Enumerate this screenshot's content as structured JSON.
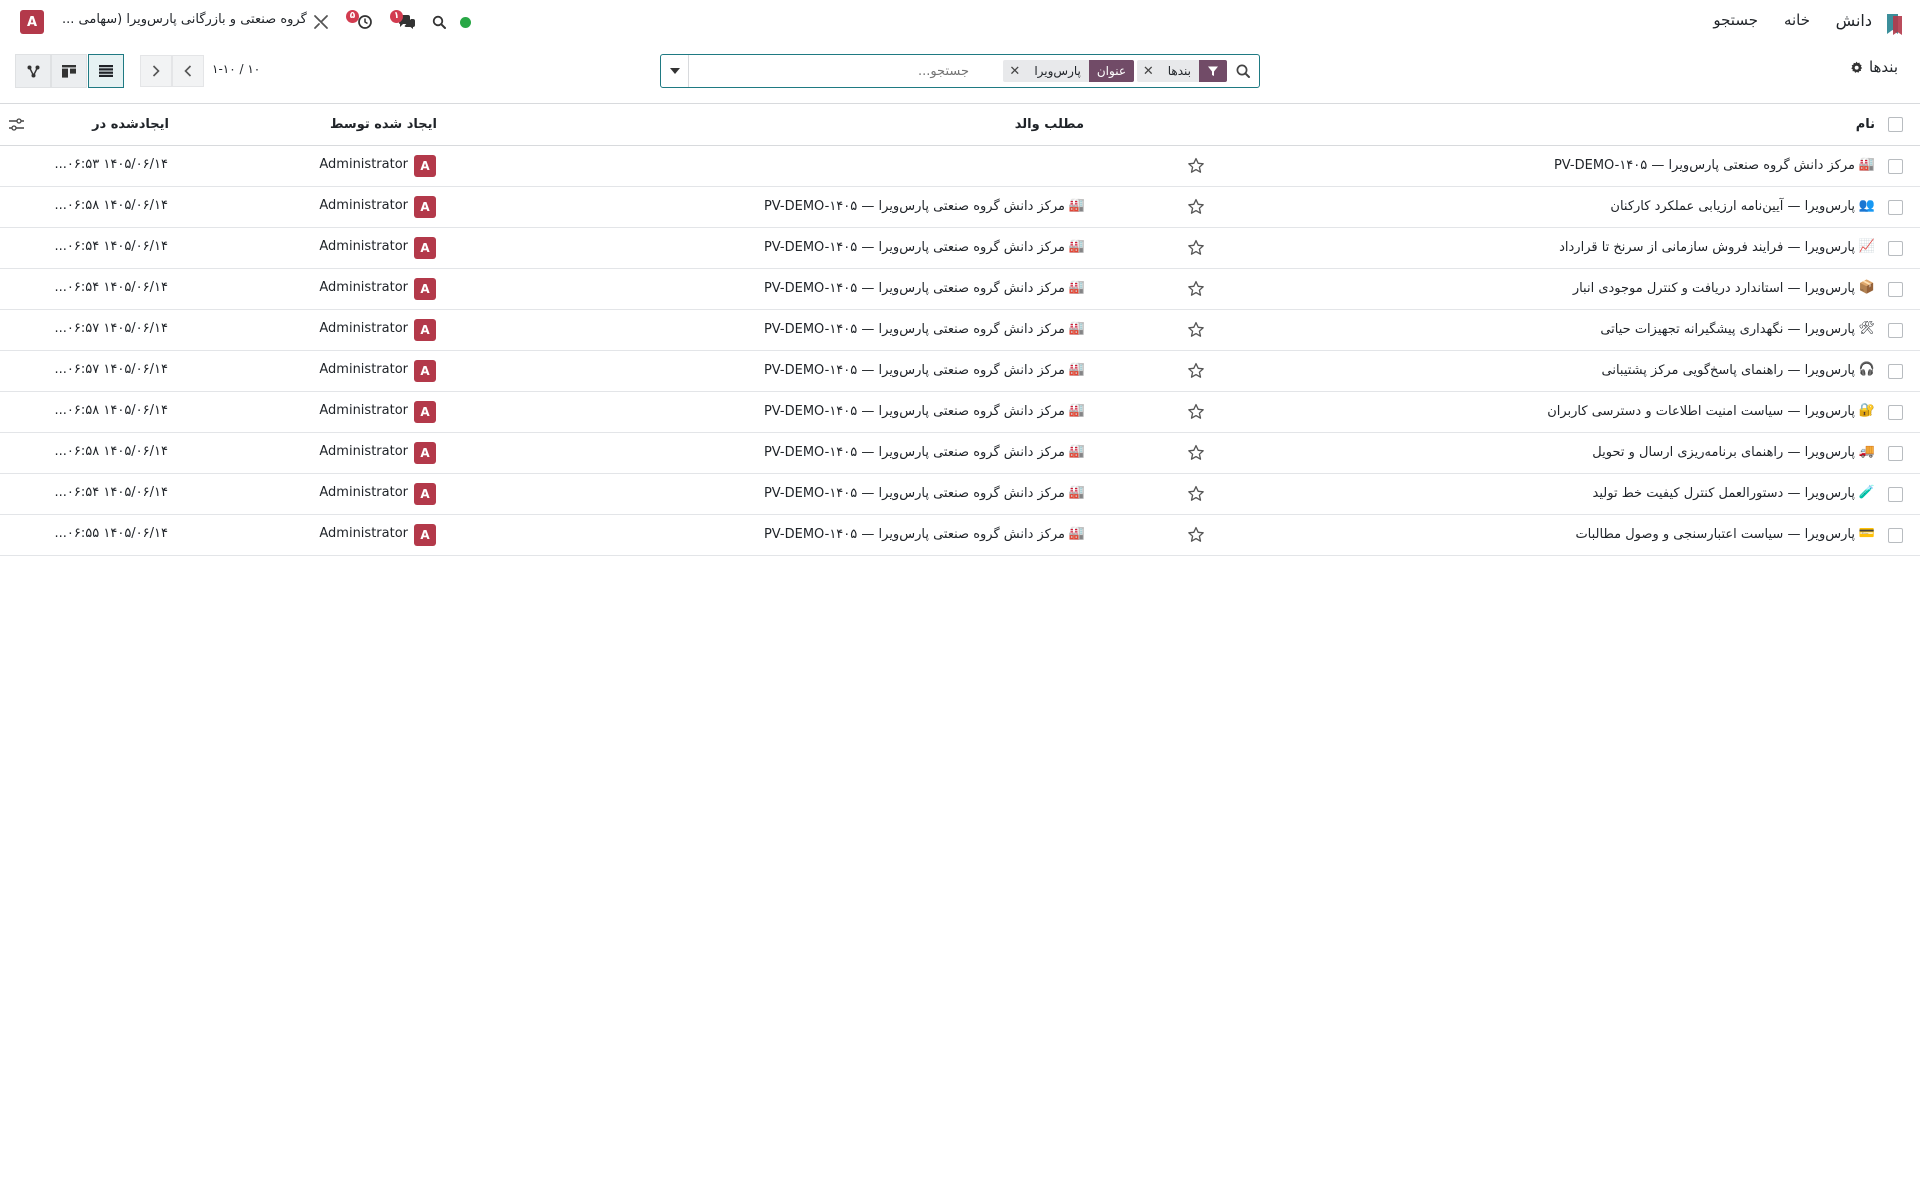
{
  "navbar": {
    "app_name": "دانش",
    "menu": [
      "خانه",
      "جستجو"
    ],
    "company": "گروه صنعتی و بازرگانی پارس‌ویرا (سهامی ...",
    "user_initial": "A",
    "activity_badge": "۵",
    "messages_badge": "۱",
    "icons": [
      "knowledge-logo-icon",
      "search-icon",
      "messages-icon",
      "activity-clock-icon",
      "tools-icon",
      "status-online-icon"
    ],
    "colors": {
      "badge": "#d23c50",
      "online": "#28a745",
      "avatar": "#b3394a"
    }
  },
  "control_panel": {
    "title": "بندها",
    "search": {
      "facets": [
        {
          "label": "بندها",
          "type": "filter"
        },
        {
          "label": "عنوان",
          "value": "پارس‌ویرا",
          "type": "field"
        }
      ],
      "placeholder": "جستجو..."
    },
    "pager": "۱-۱۰ / ۱۰",
    "views": [
      "list",
      "kanban",
      "hierarchy"
    ],
    "active_view": "list",
    "colors": {
      "facet": "#714b67",
      "accent": "#1f7a83"
    }
  },
  "table": {
    "headers": {
      "name": "نام",
      "parent": "مطلب والد",
      "created_by": "ایجاد شده توسط",
      "created_on": "ایجادشده در"
    },
    "rows": [
      {
        "icon": "🏭",
        "name": "مرکز دانش گروه صنعتی پارس‌ویرا — PV-DEMO-۱۴۰۵",
        "parent_icon": "",
        "parent": "",
        "creator_initial": "A",
        "creator": "Administrator",
        "created": "۱۴۰۵/۰۶/۱۴ ۰۶:۵۳..."
      },
      {
        "icon": "👥",
        "name": "پارس‌ویرا — آیین‌نامه ارزیابی عملکرد کارکنان",
        "parent_icon": "🏭",
        "parent": "مرکز دانش گروه صنعتی پارس‌ویرا — PV-DEMO-۱۴۰۵",
        "creator_initial": "A",
        "creator": "Administrator",
        "created": "۱۴۰۵/۰۶/۱۴ ۰۶:۵۸..."
      },
      {
        "icon": "📈",
        "name": "پارس‌ویرا — فرایند فروش سازمانی از سرنخ تا قرارداد",
        "parent_icon": "🏭",
        "parent": "مرکز دانش گروه صنعتی پارس‌ویرا — PV-DEMO-۱۴۰۵",
        "creator_initial": "A",
        "creator": "Administrator",
        "created": "۱۴۰۵/۰۶/۱۴ ۰۶:۵۴..."
      },
      {
        "icon": "📦",
        "name": "پارس‌ویرا — استاندارد دریافت و کنترل موجودی انبار",
        "parent_icon": "🏭",
        "parent": "مرکز دانش گروه صنعتی پارس‌ویرا — PV-DEMO-۱۴۰۵",
        "creator_initial": "A",
        "creator": "Administrator",
        "created": "۱۴۰۵/۰۶/۱۴ ۰۶:۵۴..."
      },
      {
        "icon": "🛠",
        "name": "پارس‌ویرا — نگهداری پیشگیرانه تجهیزات حیاتی",
        "parent_icon": "🏭",
        "parent": "مرکز دانش گروه صنعتی پارس‌ویرا — PV-DEMO-۱۴۰۵",
        "creator_initial": "A",
        "creator": "Administrator",
        "created": "۱۴۰۵/۰۶/۱۴ ۰۶:۵۷..."
      },
      {
        "icon": "🎧",
        "name": "پارس‌ویرا — راهنمای پاسخ‌گویی مرکز پشتیبانی",
        "parent_icon": "🏭",
        "parent": "مرکز دانش گروه صنعتی پارس‌ویرا — PV-DEMO-۱۴۰۵",
        "creator_initial": "A",
        "creator": "Administrator",
        "created": "۱۴۰۵/۰۶/۱۴ ۰۶:۵۷..."
      },
      {
        "icon": "🔐",
        "name": "پارس‌ویرا — سیاست امنیت اطلاعات و دسترسی کاربران",
        "parent_icon": "🏭",
        "parent": "مرکز دانش گروه صنعتی پارس‌ویرا — PV-DEMO-۱۴۰۵",
        "creator_initial": "A",
        "creator": "Administrator",
        "created": "۱۴۰۵/۰۶/۱۴ ۰۶:۵۸..."
      },
      {
        "icon": "🚚",
        "name": "پارس‌ویرا — راهنمای برنامه‌ریزی ارسال و تحویل",
        "parent_icon": "🏭",
        "parent": "مرکز دانش گروه صنعتی پارس‌ویرا — PV-DEMO-۱۴۰۵",
        "creator_initial": "A",
        "creator": "Administrator",
        "created": "۱۴۰۵/۰۶/۱۴ ۰۶:۵۸..."
      },
      {
        "icon": "🧪",
        "name": "پارس‌ویرا — دستورالعمل کنترل کیفیت خط تولید",
        "parent_icon": "🏭",
        "parent": "مرکز دانش گروه صنعتی پارس‌ویرا — PV-DEMO-۱۴۰۵",
        "creator_initial": "A",
        "creator": "Administrator",
        "created": "۱۴۰۵/۰۶/۱۴ ۰۶:۵۴..."
      },
      {
        "icon": "💳",
        "name": "پارس‌ویرا — سیاست اعتبارسنجی و وصول مطالبات",
        "parent_icon": "🏭",
        "parent": "مرکز دانش گروه صنعتی پارس‌ویرا — PV-DEMO-۱۴۰۵",
        "creator_initial": "A",
        "creator": "Administrator",
        "created": "۱۴۰۵/۰۶/۱۴ ۰۶:۵۵..."
      }
    ]
  }
}
